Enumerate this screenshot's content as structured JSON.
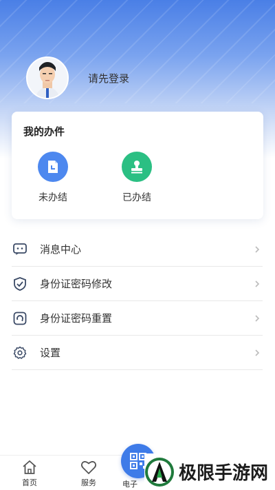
{
  "profile": {
    "login_prompt": "请先登录"
  },
  "my_tasks": {
    "title": "我的办件",
    "items": [
      {
        "label": "未办结",
        "icon": "clock-document-icon",
        "color": "#4d88ef"
      },
      {
        "label": "已办结",
        "icon": "stamp-icon",
        "color": "#2bbf83"
      }
    ]
  },
  "menu": {
    "items": [
      {
        "label": "消息中心",
        "icon": "message-icon"
      },
      {
        "label": "身份证密码修改",
        "icon": "shield-check-icon"
      },
      {
        "label": "身份证密码重置",
        "icon": "reset-icon"
      },
      {
        "label": "设置",
        "icon": "gear-icon"
      }
    ]
  },
  "tabbar": {
    "items": [
      {
        "label": "首页",
        "icon": "home-icon"
      },
      {
        "label": "服务",
        "icon": "heart-icon"
      },
      {
        "label": "电子",
        "icon": "qr-code-icon"
      }
    ]
  },
  "watermark": {
    "text": "极限手游网"
  },
  "colors": {
    "primary": "#3e7be8",
    "success": "#2bbf83",
    "header_top": "#4a7fe6"
  }
}
